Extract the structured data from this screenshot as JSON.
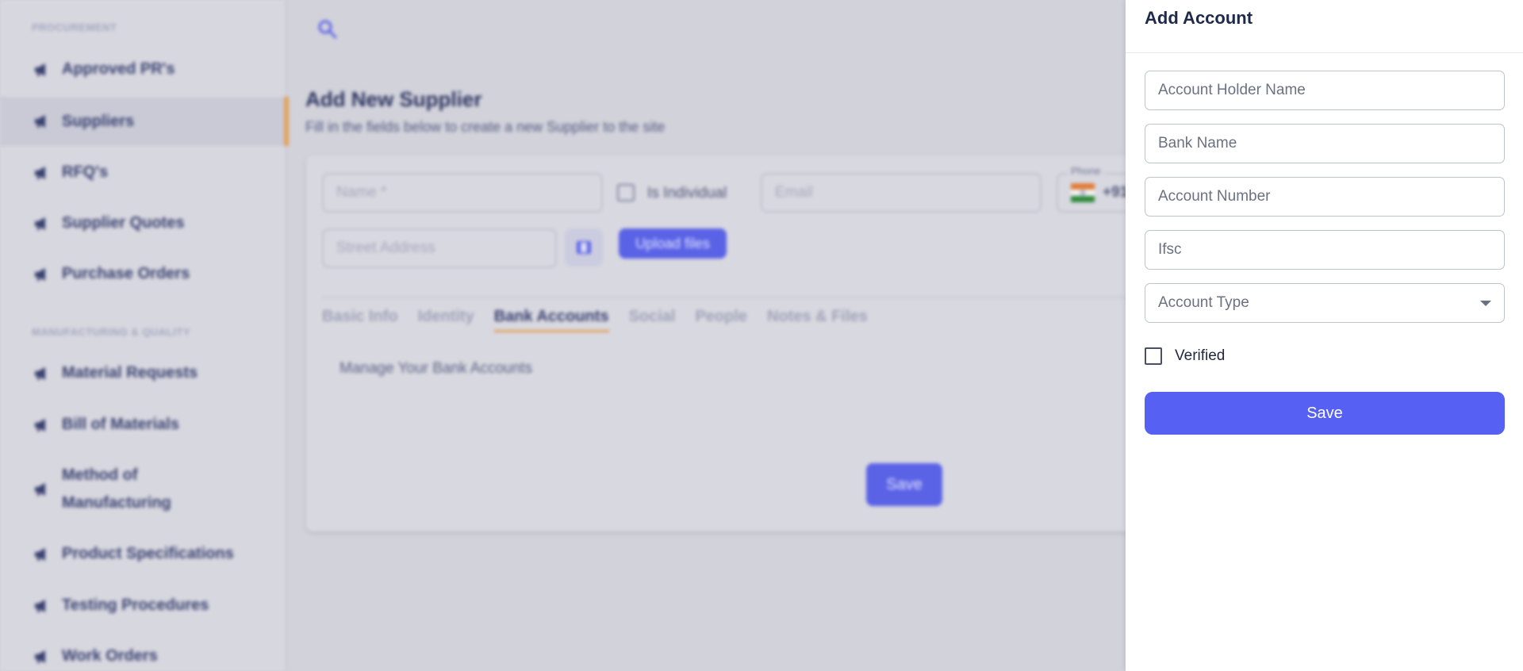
{
  "sidebar": {
    "sections": [
      {
        "title": "PROCUREMENT"
      },
      {
        "title": "MANUFACTURING & QUALITY"
      }
    ],
    "items": [
      {
        "label": "Approved PR's"
      },
      {
        "label": "Suppliers"
      },
      {
        "label": "RFQ's"
      },
      {
        "label": "Supplier Quotes"
      },
      {
        "label": "Purchase Orders"
      },
      {
        "label": "Material Requests"
      },
      {
        "label": "Bill of Materials"
      },
      {
        "label": "Method of Manufacturing"
      },
      {
        "label": "Product Specifications"
      },
      {
        "label": "Testing Procedures"
      },
      {
        "label": "Work Orders"
      }
    ],
    "active_item": "Suppliers"
  },
  "main": {
    "title": "Add New Supplier",
    "subtitle": "Fill in the fields below to create a new Supplier to the site",
    "form": {
      "name_placeholder": "Name *",
      "is_individual_label": "Is Individual",
      "email_placeholder": "Email",
      "phone_label": "Phone",
      "phone_code": "+91",
      "street_placeholder": "Street Address",
      "upload_label": "Upload files"
    },
    "tabs": [
      {
        "label": "Basic Info"
      },
      {
        "label": "Identity"
      },
      {
        "label": "Bank Accounts"
      },
      {
        "label": "Social"
      },
      {
        "label": "People"
      },
      {
        "label": "Notes & Files"
      }
    ],
    "active_tab": "Bank Accounts",
    "bank_note": "Manage Your Bank Accounts",
    "save_label": "Save"
  },
  "drawer": {
    "title": "Add Account",
    "fields": {
      "account_holder_placeholder": "Account Holder Name",
      "bank_name_placeholder": "Bank Name",
      "account_number_placeholder": "Account Number",
      "ifsc_placeholder": "Ifsc",
      "account_type_placeholder": "Account Type"
    },
    "verified_label": "Verified",
    "verified_checked": false,
    "save_label": "Save"
  },
  "colors": {
    "primary": "#5660f2",
    "accent": "#e0a25a",
    "navy": "#2c335f"
  }
}
